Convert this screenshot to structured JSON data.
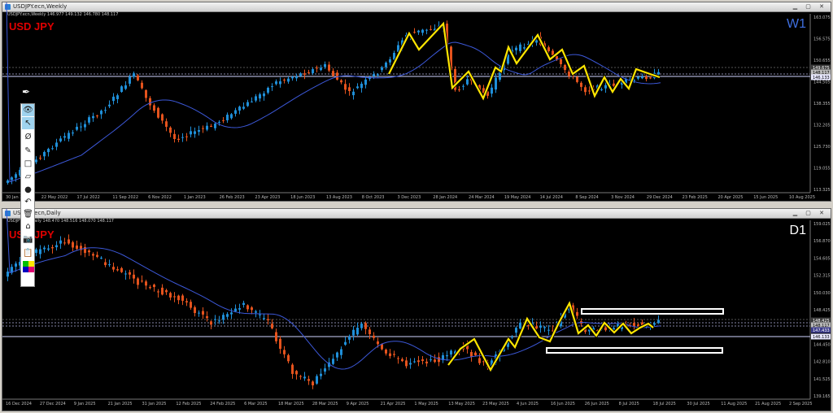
{
  "weekly": {
    "window_title": "USDJPY.ecn,Weekly",
    "info": "USDJPY.ecn,Weekly  146.977 149.132 146.780 148.117",
    "symbol": "USD JPY",
    "timeframe": "W1",
    "x_labels": [
      "30 Jan 2022",
      "22 May 2022",
      "17 Jul 2022",
      "11 Sep 2022",
      "6 Nov 2022",
      "1 Jan 2023",
      "26 Feb 2023",
      "23 Apr 2023",
      "18 Jun 2023",
      "13 Aug 2023",
      "8 Oct 2023",
      "3 Dec 2023",
      "28 Jan 2024",
      "24 Mar 2024",
      "19 May 2024",
      "14 Jul 2024",
      "8 Sep 2024",
      "3 Nov 2024",
      "29 Dec 2024",
      "23 Feb 2025",
      "20 Apr 2025",
      "15 Jun 2025",
      "10 Aug 2025"
    ],
    "y_labels": [
      "163.075",
      "156.575",
      "150.655",
      "144.505",
      "138.355",
      "132.205",
      "125.730",
      "119.055",
      "113.325"
    ],
    "price_tags": [
      "149.675",
      "148.117",
      "146.133"
    ]
  },
  "daily": {
    "window_title": "USDJPY.ecn,Daily",
    "info": "USDJPY.ecn,Daily  148.470 148.516 148.070 148.117",
    "symbol": "USD JPY",
    "timeframe": "D1",
    "x_labels": [
      "16 Dec 2024",
      "27 Dec 2024",
      "9 Jan 2025",
      "21 Jan 2025",
      "31 Jan 2025",
      "12 Feb 2025",
      "24 Feb 2025",
      "6 Mar 2025",
      "18 Mar 2025",
      "28 Mar 2025",
      "9 Apr 2025",
      "21 Apr 2025",
      "1 May 2025",
      "13 May 2025",
      "23 May 2025",
      "4 Jun 2025",
      "16 Jun 2025",
      "26 Jun 2025",
      "8 Jul 2025",
      "18 Jul 2025",
      "30 Jul 2025",
      "11 Aug 2025",
      "21 Aug 2025",
      "2 Sep 2025"
    ],
    "y_labels": [
      "159.025",
      "156.870",
      "154.605",
      "152.315",
      "150.030",
      "148.425",
      "146.115",
      "144.450",
      "142.810",
      "141.525",
      "139.165"
    ],
    "price_tags": [
      "148.425",
      "148.117",
      "147.433",
      "146.133"
    ]
  },
  "toolbar": {
    "tools": [
      "eye-icon",
      "cursor-icon",
      "magnet-icon",
      "pencil-icon",
      "rectangle-icon",
      "ruler-icon",
      "dot-icon",
      "undo-icon",
      "trash-icon",
      "hide-icon",
      "camera-icon",
      "notes-icon",
      "palette-icon"
    ]
  },
  "colors": {
    "bull": "#1f8fd8",
    "bear": "#e5531d",
    "ma": "#3c58d8",
    "zigzag": "#ffe600",
    "symbol": "#e00000"
  }
}
